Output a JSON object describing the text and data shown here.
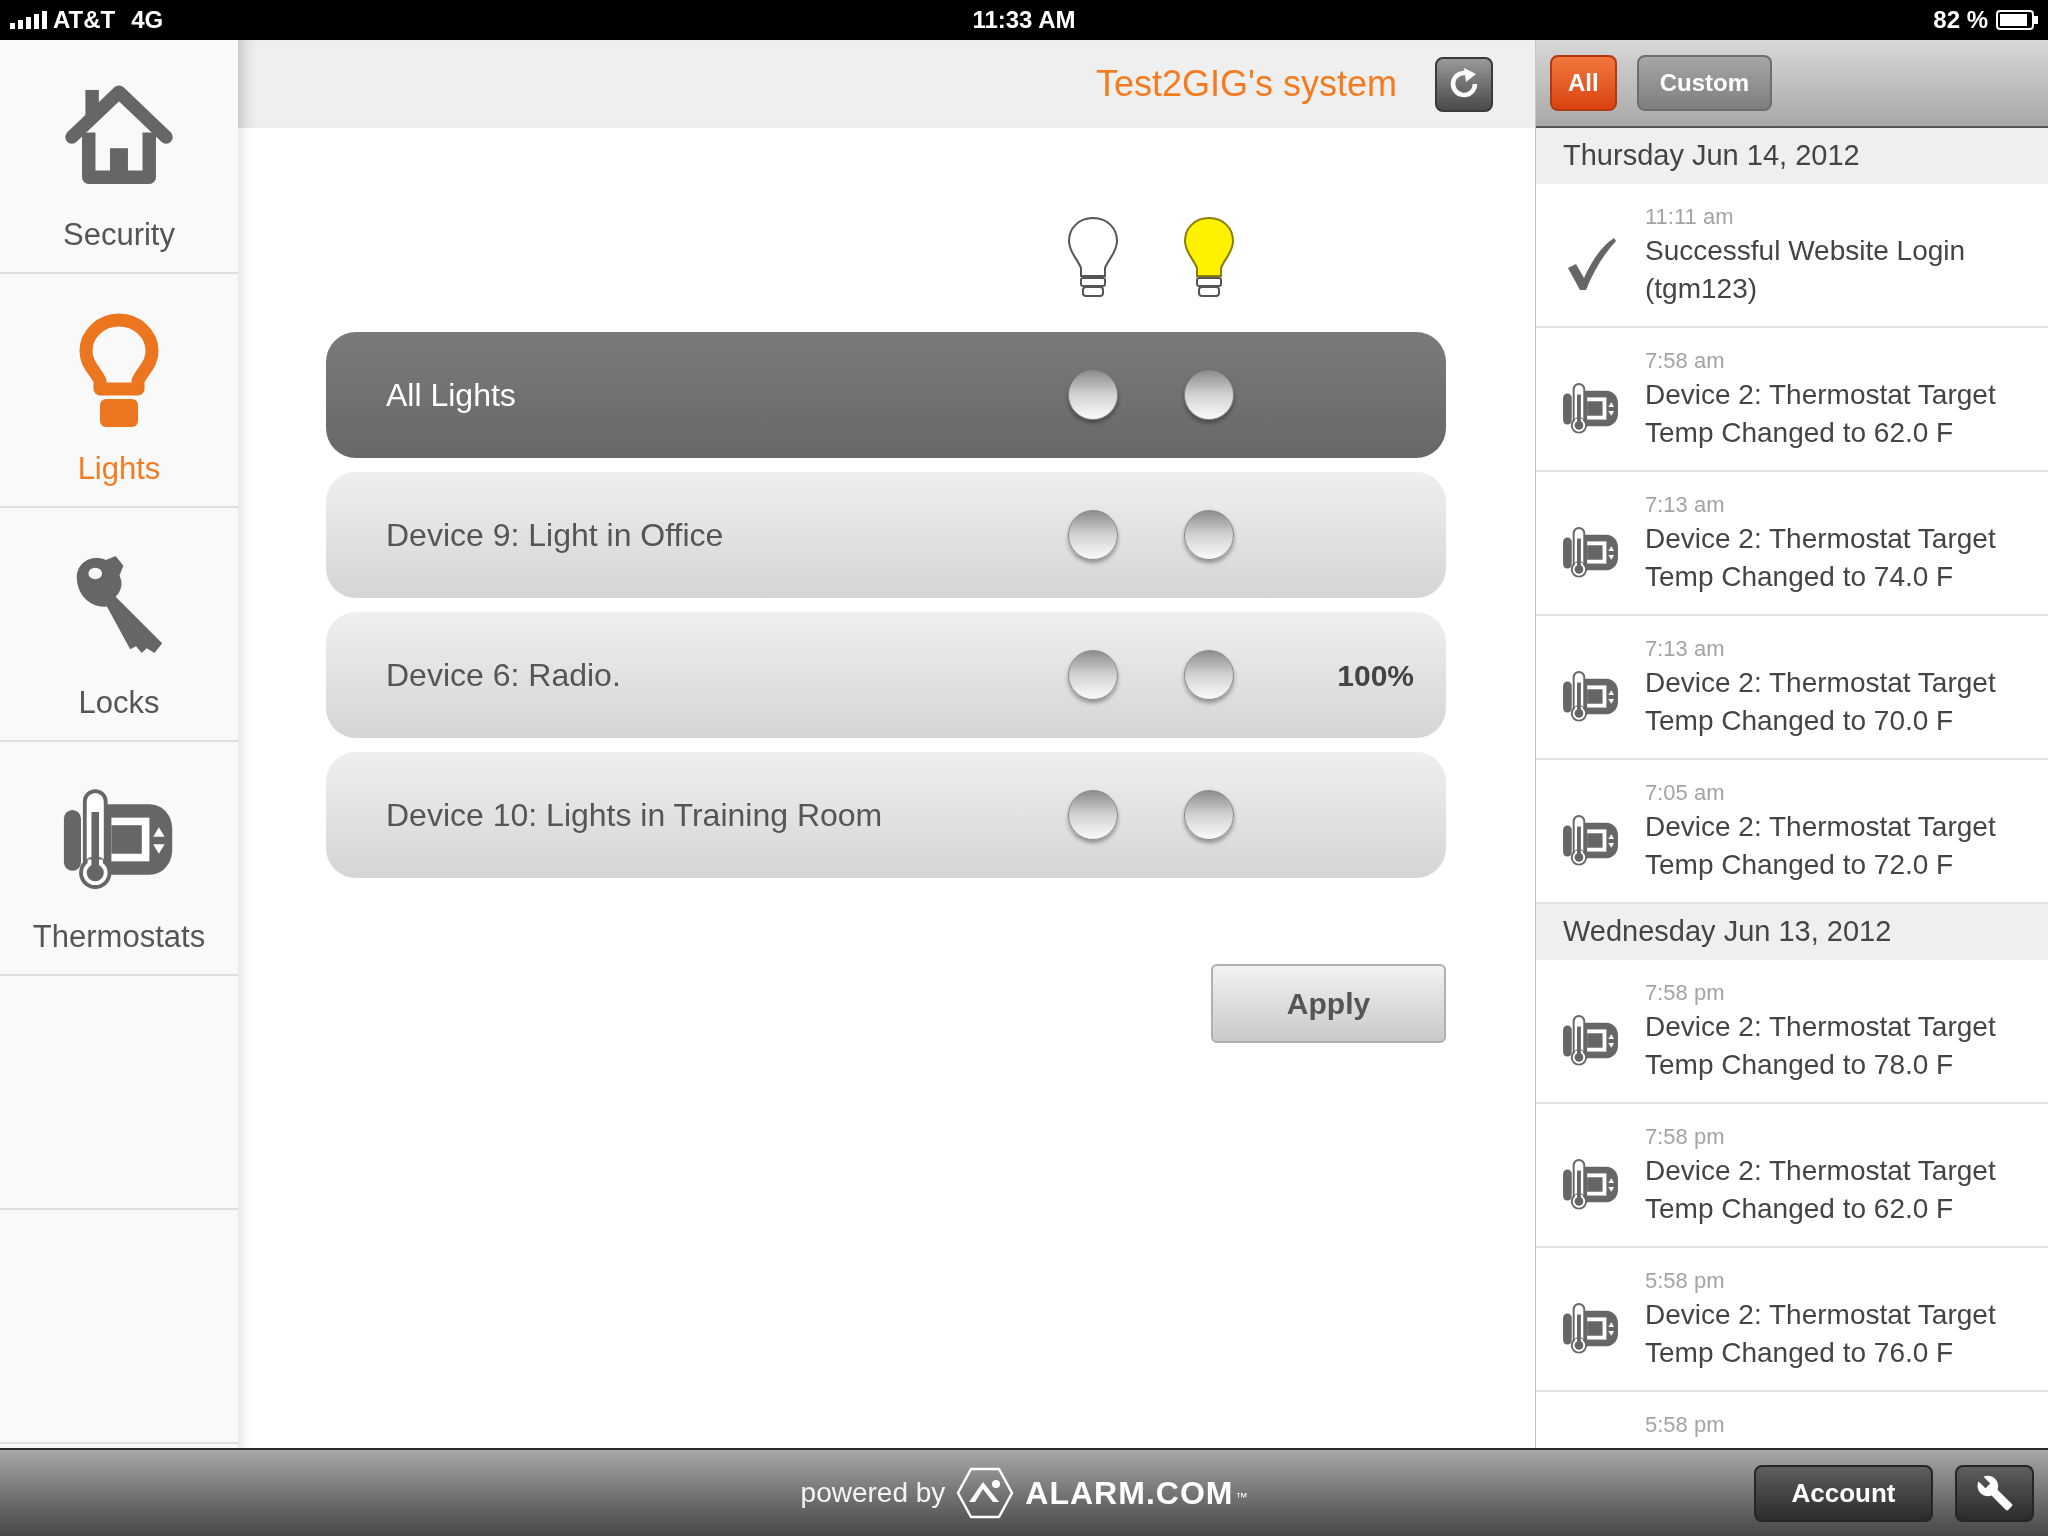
{
  "status_bar": {
    "carrier": "AT&T",
    "network": "4G",
    "time": "11:33 AM",
    "battery": "82 %"
  },
  "sidebar": {
    "items": [
      {
        "label": "Security",
        "selected": false
      },
      {
        "label": "Lights",
        "selected": true
      },
      {
        "label": "Locks",
        "selected": false
      },
      {
        "label": "Thermostats",
        "selected": false
      }
    ]
  },
  "header": {
    "title": "Test2GIG's system"
  },
  "lights": {
    "rows": [
      {
        "kind": "group",
        "name": "All Lights",
        "options": [
          {
            "selected": false
          },
          {
            "selected": false
          }
        ]
      },
      {
        "kind": "device",
        "name": "Device 9: Light in Office",
        "options": [
          {
            "selected": false
          },
          {
            "selected": false
          }
        ]
      },
      {
        "kind": "device",
        "name": "Device 6: Radio.",
        "options": [
          {
            "selected": false
          },
          {
            "selected": false
          }
        ],
        "reading": "100%"
      },
      {
        "kind": "device",
        "name": "Device 10: Lights in Training Room",
        "options": [
          {
            "selected": false
          },
          {
            "selected": false
          }
        ]
      }
    ],
    "apply_button": "Apply"
  },
  "activity": {
    "filters": [
      {
        "label": "All",
        "selected": true
      },
      {
        "label": "Custom",
        "selected": false
      }
    ],
    "days": [
      {
        "date": "Thursday Jun 14, 2012",
        "events": [
          {
            "kind": "login",
            "time": "11:11 am",
            "text": "Successful Website Login (tgm123)"
          },
          {
            "kind": "thermostat",
            "time": "7:58 am",
            "text": "Device 2: Thermostat Target Temp Changed to 62.0 F"
          },
          {
            "kind": "thermostat",
            "time": "7:13 am",
            "text": "Device 2: Thermostat Target Temp Changed to 74.0 F"
          },
          {
            "kind": "thermostat",
            "time": "7:13 am",
            "text": "Device 2: Thermostat Target Temp Changed to 70.0 F"
          },
          {
            "kind": "thermostat",
            "time": "7:05 am",
            "text": "Device 2: Thermostat Target Temp Changed to 72.0 F"
          }
        ]
      },
      {
        "date": "Wednesday Jun 13, 2012",
        "events": [
          {
            "kind": "thermostat",
            "time": "7:58 pm",
            "text": "Device 2: Thermostat Target Temp Changed to 78.0 F"
          },
          {
            "kind": "thermostat",
            "time": "7:58 pm",
            "text": "Device 2: Thermostat Target Temp Changed to 62.0 F"
          },
          {
            "kind": "thermostat",
            "time": "5:58 pm",
            "text": "Device 2: Thermostat Target Temp Changed to 76.0 F"
          },
          {
            "kind": "thermostat",
            "time": "5:58 pm"
          }
        ]
      }
    ]
  },
  "footer": {
    "powered_by": "powered by",
    "brand": "ALARM.COM",
    "trademark": "™",
    "account_button": "Account"
  }
}
